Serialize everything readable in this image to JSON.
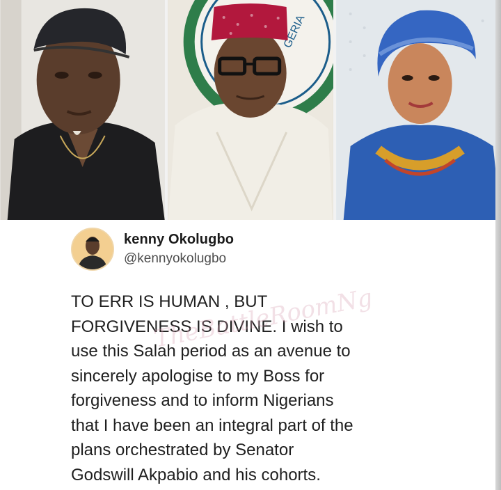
{
  "photos": [
    {
      "icon": "man-in-black-cap-photo"
    },
    {
      "icon": "senator-red-cap-photo"
    },
    {
      "icon": "woman-blue-gele-photo"
    }
  ],
  "tweet": {
    "display_name": "kenny Okolugbo",
    "handle": "@kennyokolugbo",
    "avatar_icon": "avatar-photo",
    "lines": [
      "TO ERR IS HUMAN , BUT",
      "FORGIVENESS IS DIVINE. I wish  to",
      "use this Salah period  as an avenue to",
      "sincerely apologise to my Boss for",
      "forgiveness and to inform  Nigerians",
      "that I have been an integral part of the",
      "plans  orchestrated  by Senator",
      "Godswill Akpabio  and his cohorts."
    ]
  },
  "watermark": "TheBattleRoomNg",
  "colors": {
    "text": "#1f1f1f",
    "handle": "#4d4d4d",
    "cap_red": "#b2183d",
    "gele_blue": "#2d5fb4"
  }
}
